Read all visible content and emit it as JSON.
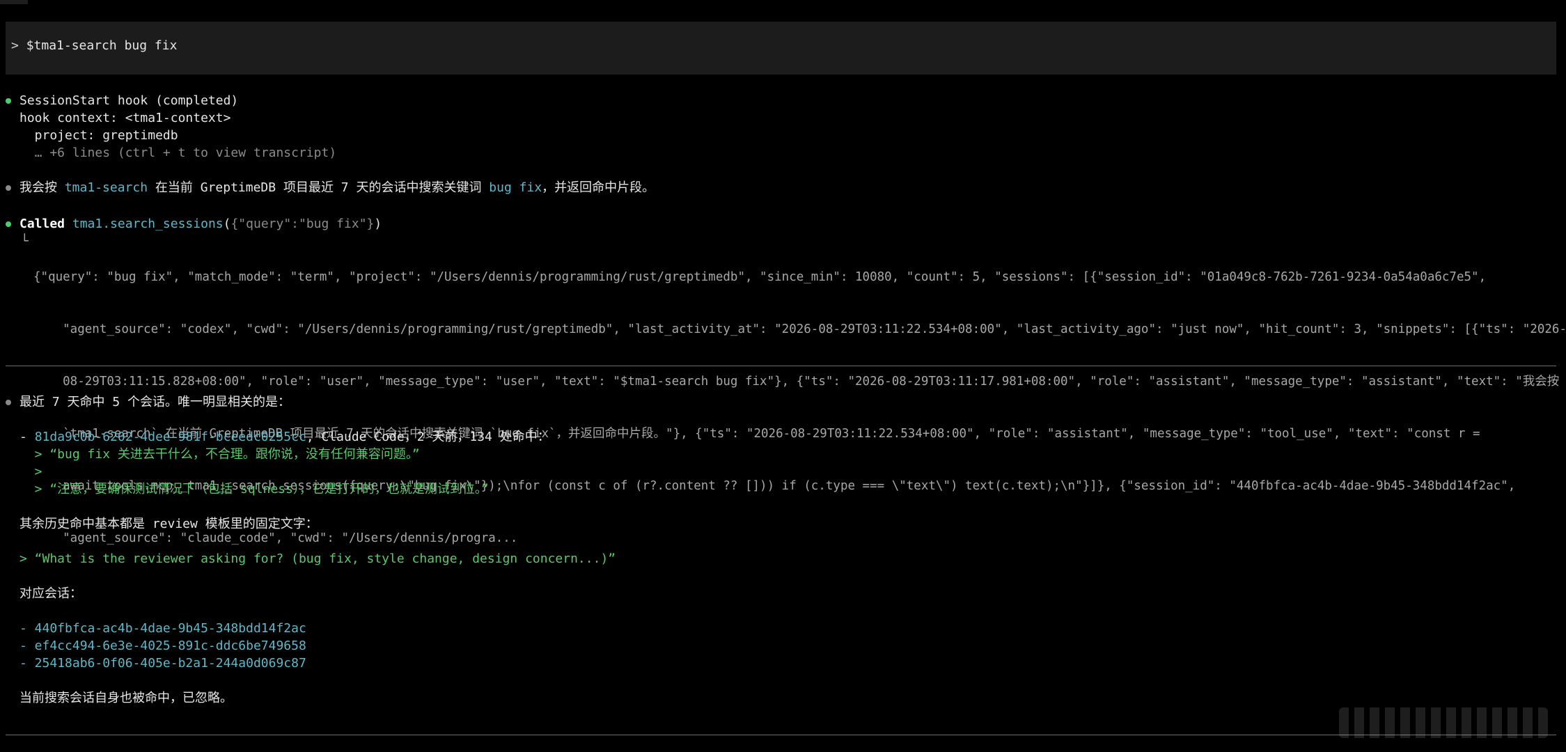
{
  "colors": {
    "background": "#000000",
    "prompt_bg": "#1c1c1c",
    "text": "#e6e6e6",
    "dim": "#8c8c8c",
    "cyan": "#5fb8c9",
    "green": "#5cc96a",
    "bullet_green": "#47d16c",
    "bullet_gray": "#8a8a8a",
    "separator": "#6e6e6e"
  },
  "prompt": {
    "caret": ">",
    "command": "$tma1-search bug fix"
  },
  "hook": {
    "title": "SessionStart hook (completed)",
    "context_line": "hook context: <tma1-context>",
    "project_line": "  project: greptimedb",
    "more_line": "  … +6 lines (ctrl + t to view transcript)"
  },
  "intro": {
    "p1": "我会按 ",
    "p2": "tma1-search",
    "p3": " 在当前 GreptimeDB 项目最近 7 天的会话中搜索关键词 ",
    "p4": "bug fix",
    "p5": "，并返回命中片段。"
  },
  "call": {
    "label": "Called",
    "tool": "tma1.search_sessions",
    "args_open": "(",
    "args": "{\"query\":\"bug fix\"}",
    "args_close": ")",
    "corner": "└",
    "output": [
      "{\"query\": \"bug fix\", \"match_mode\": \"term\", \"project\": \"/Users/dennis/programming/rust/greptimedb\", \"since_min\": 10080, \"count\": 5, \"sessions\": [{\"session_id\": \"01a049c8-762b-7261-9234-0a54a0a6c7e5\",",
      "    \"agent_source\": \"codex\", \"cwd\": \"/Users/dennis/programming/rust/greptimedb\", \"last_activity_at\": \"2026-08-29T03:11:22.534+08:00\", \"last_activity_ago\": \"just now\", \"hit_count\": 3, \"snippets\": [{\"ts\": \"2026-",
      "    08-29T03:11:15.828+08:00\", \"role\": \"user\", \"message_type\": \"user\", \"text\": \"$tma1-search bug fix\"}, {\"ts\": \"2026-08-29T03:11:17.981+08:00\", \"role\": \"assistant\", \"message_type\": \"assistant\", \"text\": \"我会按",
      "    `tma1-search` 在当前 GreptimeDB 项目最近 7 天的会话中搜索关键词 `bug fix`，并返回命中片段。\"}, {\"ts\": \"2026-08-29T03:11:22.534+08:00\", \"role\": \"assistant\", \"message_type\": \"tool_use\", \"text\": \"const r =",
      "    await tools.mcp__tma1__search_sessions({query:\\\"bug fix\\\"});\\nfor (const c of (r?.content ?? [])) if (c.type === \\\"text\\\") text(c.text);\\n\"}]}, {\"session_id\": \"440fbfca-ac4b-4dae-9b45-348bdd14f2ac\",",
      "    \"agent_source\": \"claude_code\", \"cwd\": \"/Users/dennis/progra..."
    ]
  },
  "result": {
    "summary": "最近 7 天命中 5 个会话。唯一明显相关的是：",
    "hit_prefix": "- ",
    "hit_id": "81da9c0b-6202-4dee-981f-bceedc0255cc",
    "hit_suffix": ", Claude Code，2 天前，134 处命中：",
    "quote1": "  > “bug fix 关进去干什么，不合理。跟你说，没有任何兼容问题。”",
    "quote2": "  >",
    "quote3": "  > “注意，要确保测试情况下（包括 sqlness），它是打开的，也就是测试到位。”",
    "others_intro": "其余历史命中基本都是 review 模板里的固定文字：",
    "template_quote": "> “What is the reviewer asking for? (bug fix, style change, design concern...)”",
    "sessions_intro": "对应会话：",
    "sessions": [
      "- 440fbfca-ac4b-4dae-9b45-348bdd14f2ac",
      "- ef4cc494-6e3e-4025-891c-ddc6be749658",
      "- 25418ab6-0f06-405e-b2a1-244a0d069c87"
    ],
    "footer": "当前搜索会话自身也被命中，已忽略。"
  }
}
